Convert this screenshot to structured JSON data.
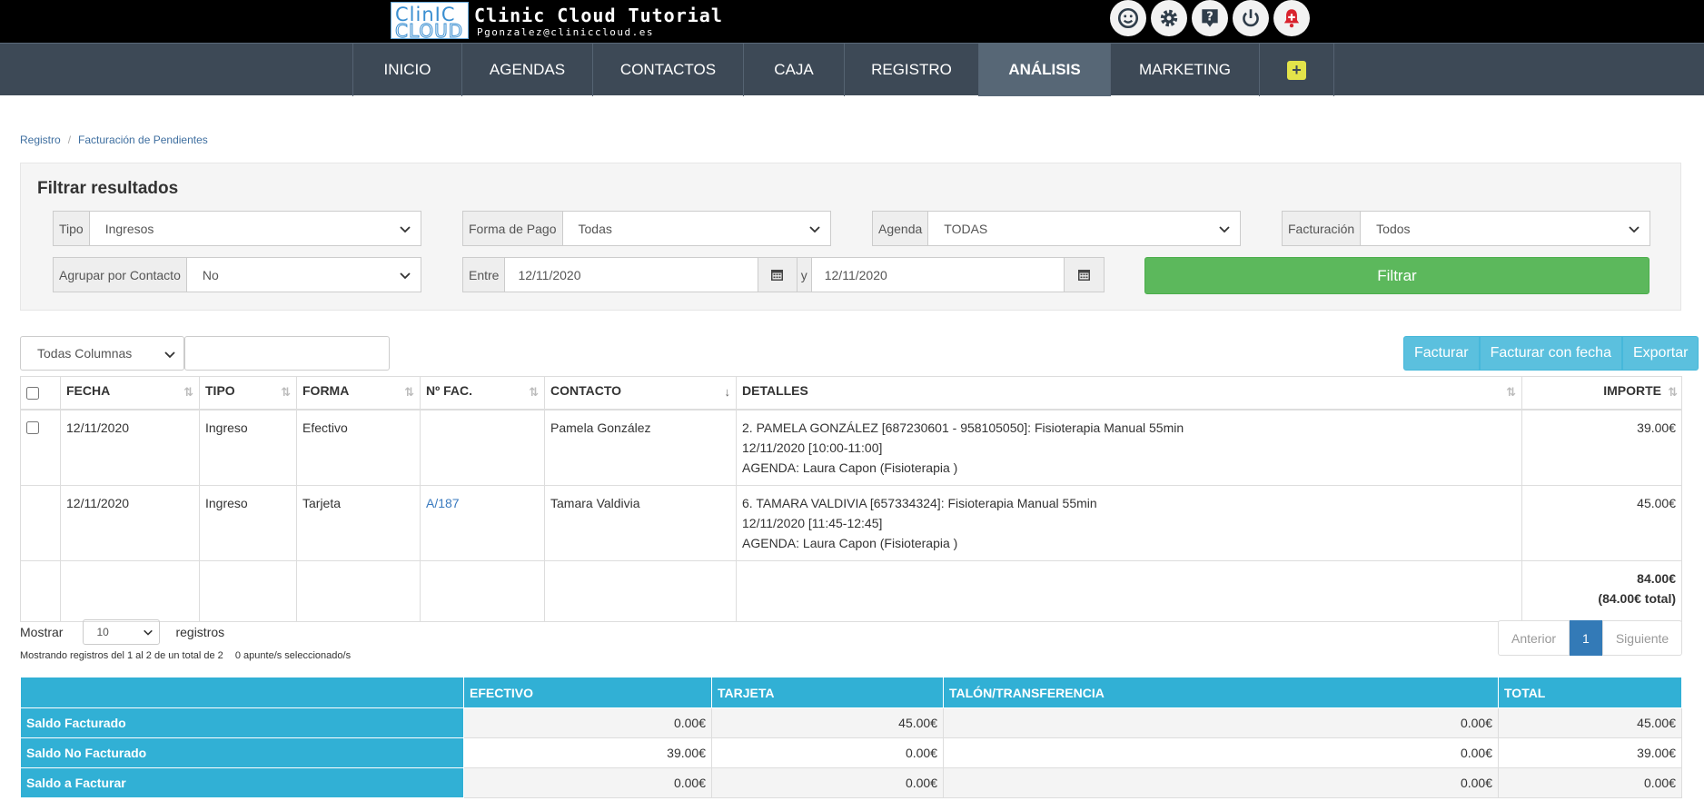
{
  "header": {
    "logo_top": "ClinIC",
    "logo_bottom": "CLOUD",
    "title": "Clinic Cloud Tutorial",
    "user_email": "Pgonzalez@cliniccloud.es",
    "icons": [
      "support-face-icon",
      "gear-icon",
      "help-icon",
      "power-icon",
      "alert-bell-icon"
    ]
  },
  "nav": {
    "items": [
      "INICIO",
      "AGENDAS",
      "CONTACTOS",
      "CAJA",
      "REGISTRO",
      "ANÁLISIS",
      "MARKETING"
    ],
    "active": "ANÁLISIS",
    "plus": "+"
  },
  "breadcrumb": {
    "parent": "Registro",
    "separator": "/",
    "current": "Facturación de Pendientes"
  },
  "filter": {
    "title": "Filtrar resultados",
    "tipo_label": "Tipo",
    "tipo_value": "Ingresos",
    "forma_label": "Forma de Pago",
    "forma_value": "Todas",
    "agenda_label": "Agenda",
    "agenda_value": "TODAS",
    "facturacion_label": "Facturación",
    "facturacion_value": "Todos",
    "agrupar_label": "Agrupar por Contacto",
    "agrupar_value": "No",
    "entre_label": "Entre",
    "date_from": "12/11/2020",
    "y_label": "y",
    "date_to": "12/11/2020",
    "button": "Filtrar"
  },
  "table_controls": {
    "columns_select": "Todas Columnas",
    "search_value": "",
    "buttons": [
      "Facturar",
      "Facturar con fecha",
      "Exportar"
    ]
  },
  "table": {
    "headers": [
      "FECHA",
      "TIPO",
      "FORMA",
      "Nº FAC.",
      "CONTACTO",
      "DETALLES",
      "IMPORTE"
    ],
    "rows": [
      {
        "fecha": "12/11/2020",
        "tipo": "Ingreso",
        "forma": "Efectivo",
        "nfac": "",
        "contacto": "Pamela González",
        "det1": "2. PAMELA GONZÁLEZ [687230601 - 958105050]: Fisioterapia Manual 55min",
        "det2": "12/11/2020 [10:00-11:00]",
        "det3": "AGENDA: Laura Capon (Fisioterapia )",
        "importe": "39.00€"
      },
      {
        "fecha": "12/11/2020",
        "tipo": "Ingreso",
        "forma": "Tarjeta",
        "nfac": "A/187",
        "contacto": "Tamara Valdivia",
        "det1": "6. TAMARA VALDIVIA [657334324]: Fisioterapia Manual 55min",
        "det2": "12/11/2020 [11:45-12:45]",
        "det3": "AGENDA: Laura Capon (Fisioterapia )",
        "importe": "45.00€"
      }
    ],
    "total": "84.00€",
    "total_all": "(84.00€ total)"
  },
  "pagination": {
    "show_label": "Mostrar",
    "page_length": "10",
    "records_label": "registros",
    "info": "Mostrando registros del 1 al 2 de un total de 2",
    "selected_info": "0 apunte/s seleccionado/s",
    "prev": "Anterior",
    "current": "1",
    "next": "Siguiente"
  },
  "summary": {
    "headers": [
      "EFECTIVO",
      "TARJETA",
      "TALÓN/TRANSFERENCIA",
      "TOTAL"
    ],
    "rows": [
      {
        "label": "Saldo Facturado",
        "values": [
          "0.00€",
          "45.00€",
          "0.00€",
          "45.00€"
        ]
      },
      {
        "label": "Saldo No Facturado",
        "values": [
          "39.00€",
          "0.00€",
          "0.00€",
          "39.00€"
        ]
      },
      {
        "label": "Saldo a Facturar",
        "values": [
          "0.00€",
          "0.00€",
          "0.00€",
          "0.00€"
        ]
      }
    ]
  },
  "colors": {
    "nav_bg": "#3d4956",
    "nav_active": "#576776",
    "filter_button": "#5cb85c",
    "action_button": "#5bc0de",
    "summary_header": "#31b0d5",
    "pager_active": "#337ab7"
  }
}
